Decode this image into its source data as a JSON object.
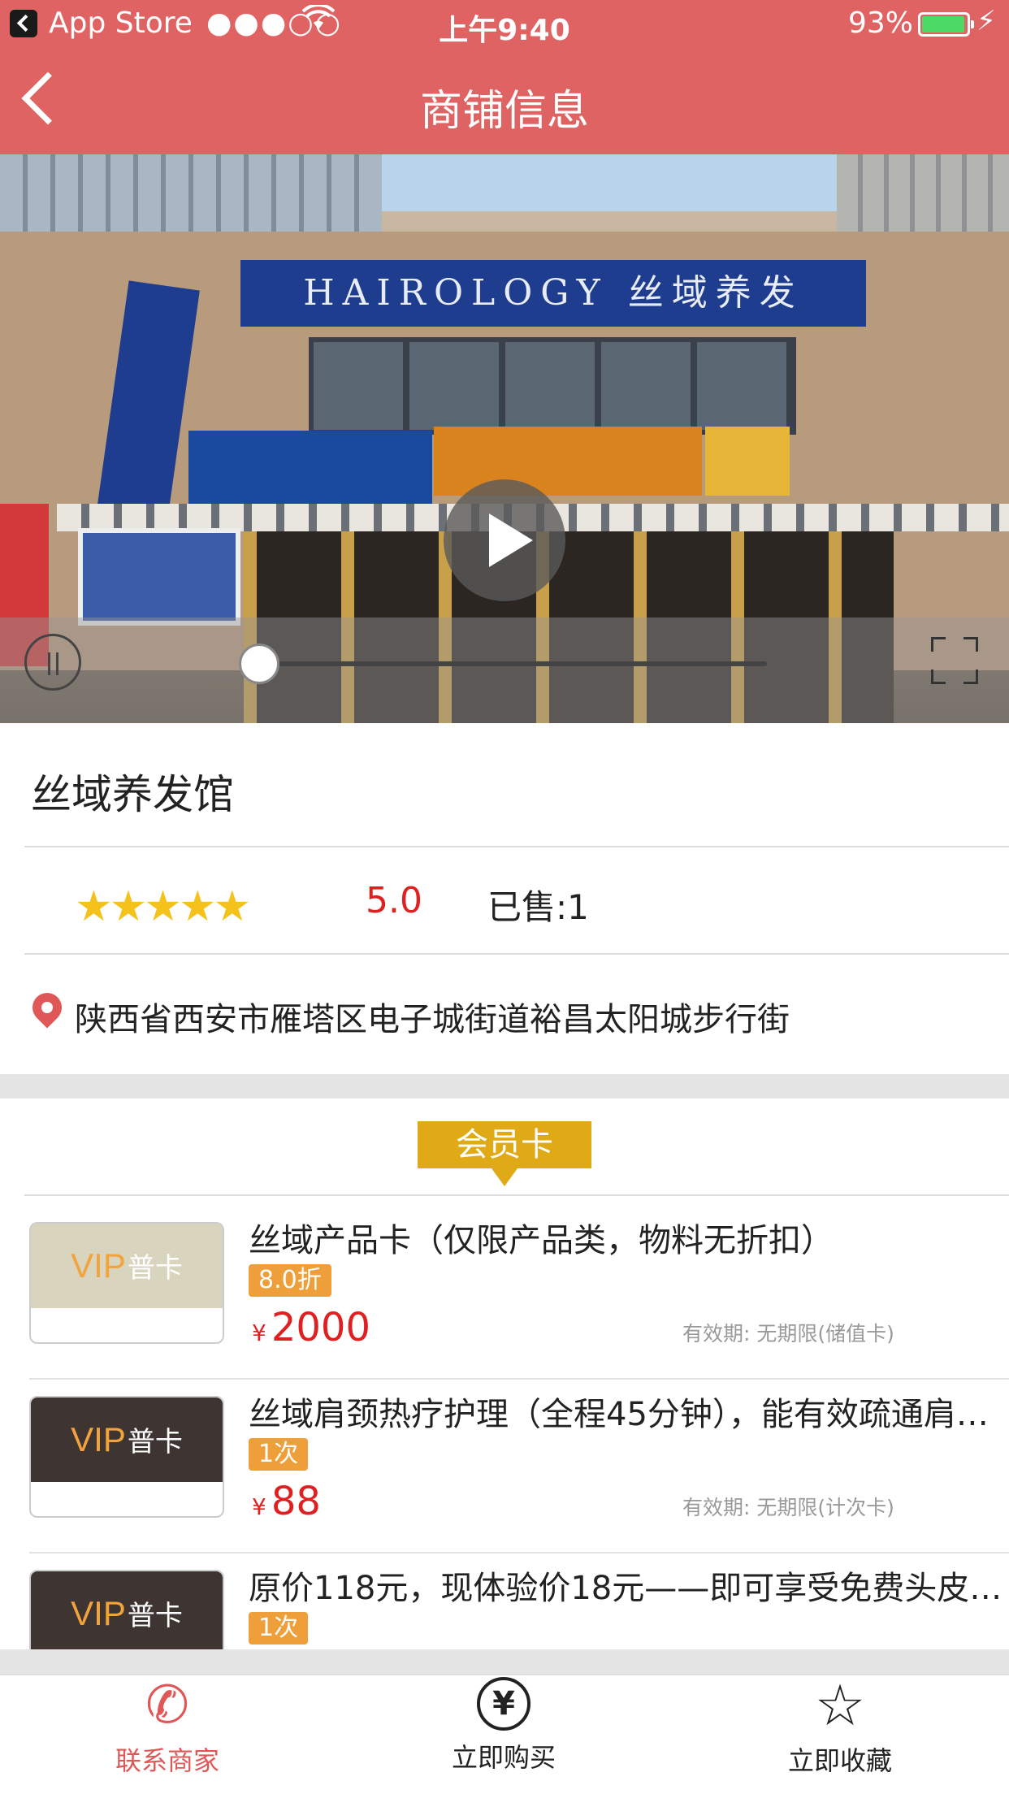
{
  "status_bar": {
    "back_app": "App Store",
    "signal": "●●●○○",
    "wifi": "wifi-icon",
    "time": "上午9:40",
    "battery": "93%"
  },
  "nav": {
    "title": "商铺信息",
    "back_icon": "back-chevron-icon"
  },
  "video": {
    "play_icon": "play-icon",
    "pause_icon": "pause-icon",
    "fullscreen_icon": "fullscreen-icon",
    "progress": 0.0
  },
  "shop": {
    "name": "丝域养发馆",
    "stars": 5,
    "rating": "5.0",
    "sold": "已售:1",
    "address": "陕西省西安市雁塔区电子城街道裕昌太阳城步行街"
  },
  "member_section": {
    "title": "会员卡",
    "cards": [
      {
        "vip_text": "VIP",
        "vip_type": "普卡",
        "style": "light",
        "title": "丝域产品卡（仅限产品类，物料无折扣）",
        "badge": "8.0折",
        "currency": "¥",
        "price": "2000",
        "validity": "有效期: 无期限(储值卡)"
      },
      {
        "vip_text": "VIP",
        "vip_type": "普卡",
        "style": "dark",
        "title": "丝域肩颈热疗护理（全程45分钟），能有效疏通肩…",
        "badge": "1次",
        "currency": "¥",
        "price": "88",
        "validity": "有效期: 无期限(计次卡)"
      },
      {
        "vip_text": "VIP",
        "vip_type": "普卡",
        "style": "dark",
        "title": "原价118元，现体验价18元——即可享受免费头皮…",
        "badge": "1次"
      }
    ]
  },
  "tabbar": {
    "contact": "联系商家",
    "buy": "立即购买",
    "favorite": "立即收藏"
  },
  "colors": {
    "header": "#E06363",
    "accent_red": "#E02020",
    "gold": "#DFAA16",
    "badge": "#EF9F3A"
  }
}
